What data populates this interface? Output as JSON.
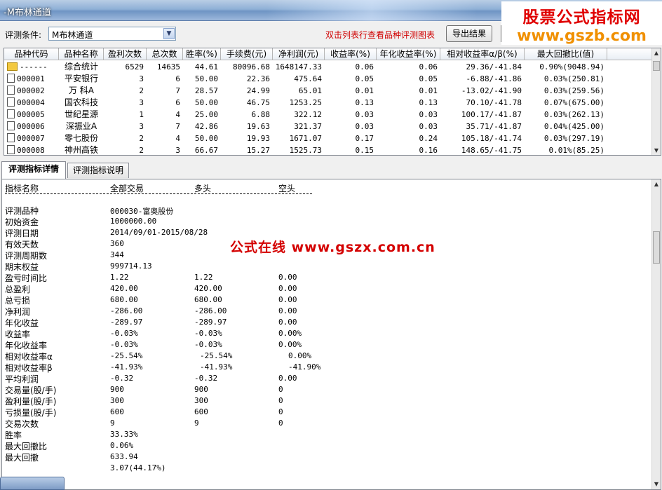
{
  "window": {
    "title": "-M布林通道"
  },
  "brand": {
    "line1": "股票公式指标网",
    "line2": "www.gszb.com"
  },
  "watermark": "公式在线  www.gszx.com.cn",
  "toolbar": {
    "condition_label": "评测条件:",
    "condition_value": "M布林通道",
    "hint": "双击列表行查看品种评测图表",
    "export_label": "导出结果"
  },
  "table": {
    "columns": [
      "品种代码",
      "品种名称",
      "盈利次数",
      "总次数",
      "胜率(%)",
      "手续费(元)",
      "净利润(元)",
      "收益率(%)",
      "年化收益率(%)",
      "相对收益率α/β(%)",
      "最大回撤比(值)"
    ],
    "rows": [
      {
        "icon": "folder",
        "code": "------",
        "name": "综合统计",
        "wins": "6529",
        "total": "14635",
        "winrate": "44.61",
        "fee": "80096.68",
        "profit": "1648147.33",
        "ret": "0.06",
        "annual": "0.06",
        "relative": "29.36/-41.84",
        "drawdown": "0.90%(9048.94)"
      },
      {
        "icon": "doc",
        "code": "000001",
        "name": "平安银行",
        "wins": "3",
        "total": "6",
        "winrate": "50.00",
        "fee": "22.36",
        "profit": "475.64",
        "ret": "0.05",
        "annual": "0.05",
        "relative": "-6.88/-41.86",
        "drawdown": "0.03%(250.81)"
      },
      {
        "icon": "doc",
        "code": "000002",
        "name": "万 科A",
        "wins": "2",
        "total": "7",
        "winrate": "28.57",
        "fee": "24.99",
        "profit": "65.01",
        "ret": "0.01",
        "annual": "0.01",
        "relative": "-13.02/-41.90",
        "drawdown": "0.03%(259.56)"
      },
      {
        "icon": "doc",
        "code": "000004",
        "name": "国农科技",
        "wins": "3",
        "total": "6",
        "winrate": "50.00",
        "fee": "46.75",
        "profit": "1253.25",
        "ret": "0.13",
        "annual": "0.13",
        "relative": "70.10/-41.78",
        "drawdown": "0.07%(675.00)"
      },
      {
        "icon": "doc",
        "code": "000005",
        "name": "世纪星源",
        "wins": "1",
        "total": "4",
        "winrate": "25.00",
        "fee": "6.88",
        "profit": "322.12",
        "ret": "0.03",
        "annual": "0.03",
        "relative": "100.17/-41.87",
        "drawdown": "0.03%(262.13)"
      },
      {
        "icon": "doc",
        "code": "000006",
        "name": "深振业A",
        "wins": "3",
        "total": "7",
        "winrate": "42.86",
        "fee": "19.63",
        "profit": "321.37",
        "ret": "0.03",
        "annual": "0.03",
        "relative": "35.71/-41.87",
        "drawdown": "0.04%(425.00)"
      },
      {
        "icon": "doc",
        "code": "000007",
        "name": "零七股份",
        "wins": "2",
        "total": "4",
        "winrate": "50.00",
        "fee": "19.93",
        "profit": "1671.07",
        "ret": "0.17",
        "annual": "0.24",
        "relative": "105.18/-41.74",
        "drawdown": "0.03%(297.19)"
      },
      {
        "icon": "doc",
        "code": "000008",
        "name": "神州高铁",
        "wins": "2",
        "total": "3",
        "winrate": "66.67",
        "fee": "15.27",
        "profit": "1525.73",
        "ret": "0.15",
        "annual": "0.16",
        "relative": "148.65/-41.75",
        "drawdown": "0.01%(85.25)"
      }
    ]
  },
  "tabs": [
    {
      "label": "评测指标详情"
    },
    {
      "label": "评测指标说明"
    }
  ],
  "detail": {
    "header": [
      "指标名称",
      "全部交易",
      "多头",
      "空头"
    ],
    "rows": [
      {
        "k": "评测品种",
        "a": "000030-富奥股份",
        "b": "",
        "c": ""
      },
      {
        "k": "初始资金",
        "a": "1000000.00",
        "b": "",
        "c": ""
      },
      {
        "k": "评测日期",
        "a": "2014/09/01-2015/08/28",
        "b": "",
        "c": ""
      },
      {
        "k": "有效天数",
        "a": "360",
        "b": "",
        "c": ""
      },
      {
        "k": "评测周期数",
        "a": "344",
        "b": "",
        "c": ""
      },
      {
        "k": "期末权益",
        "a": "999714.13",
        "b": "",
        "c": ""
      },
      {
        "k": "盈亏时间比",
        "a": "1.22",
        "b": "1.22",
        "c": "0.00"
      },
      {
        "k": "总盈利",
        "a": "420.00",
        "b": "420.00",
        "c": "0.00"
      },
      {
        "k": "总亏损",
        "a": "680.00",
        "b": "680.00",
        "c": "0.00"
      },
      {
        "k": "净利润",
        "a": "-286.00",
        "b": "-286.00",
        "c": "0.00"
      },
      {
        "k": "年化收益",
        "a": "-289.97",
        "b": "-289.97",
        "c": "0.00"
      },
      {
        "k": "收益率",
        "a": "-0.03%",
        "b": "-0.03%",
        "c": "0.00%"
      },
      {
        "k": "年化收益率",
        "a": "-0.03%",
        "b": "-0.03%",
        "c": "0.00%"
      },
      {
        "k": "相对收益率α",
        "a": "-25.54%",
        "b": "-25.54%",
        "c": "0.00%"
      },
      {
        "k": "相对收益率β",
        "a": "-41.93%",
        "b": "-41.93%",
        "c": "-41.90%"
      },
      {
        "k": "平均利润",
        "a": "-0.32",
        "b": "-0.32",
        "c": "0.00"
      },
      {
        "k": "交易量(股/手)",
        "a": "900",
        "b": "900",
        "c": "0"
      },
      {
        "k": "盈利量(股/手)",
        "a": "300",
        "b": "300",
        "c": "0"
      },
      {
        "k": "亏损量(股/手)",
        "a": "600",
        "b": "600",
        "c": "0"
      },
      {
        "k": "交易次数",
        "a": "9",
        "b": "9",
        "c": "0"
      },
      {
        "k": "胜率",
        "a": "33.33%",
        "b": "",
        "c": ""
      },
      {
        "k": "最大回撤比",
        "a": "0.06%",
        "b": "",
        "c": ""
      },
      {
        "k": "最大回撤",
        "a": "633.94",
        "b": "",
        "c": ""
      },
      {
        "k": "",
        "a": "3.07(44.17%)",
        "b": "",
        "c": ""
      }
    ]
  }
}
